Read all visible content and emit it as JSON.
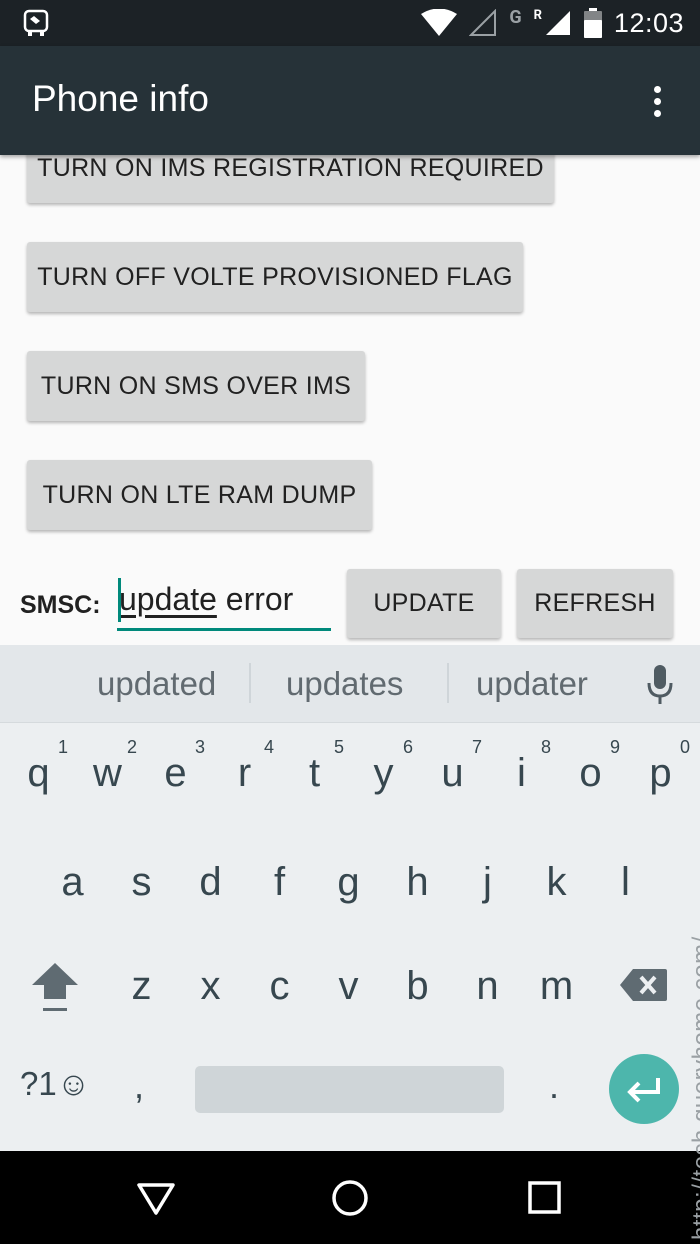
{
  "status_bar": {
    "time": "12:03",
    "network_type": "G",
    "roaming": "R",
    "icons": [
      "app-notification-icon",
      "wifi-icon",
      "signal-empty-icon",
      "signal-roaming-icon",
      "battery-icon"
    ]
  },
  "app_bar": {
    "title": "Phone info",
    "overflow_icon": "more-vert-icon"
  },
  "buttons": [
    {
      "label": "TURN ON IMS REGISTRATION REQUIRED"
    },
    {
      "label": "TURN OFF VOLTE PROVISIONED FLAG"
    },
    {
      "label": "TURN ON SMS OVER IMS"
    },
    {
      "label": "TURN ON LTE RAM DUMP"
    }
  ],
  "smsc": {
    "label": "SMSC:",
    "value_composing": "update",
    "value_rest": " error",
    "update_label": "UPDATE",
    "refresh_label": "REFRESH",
    "accent_color": "#00897b"
  },
  "keyboard": {
    "suggestions": [
      "updated",
      "updates",
      "updater"
    ],
    "row1": [
      {
        "ch": "q",
        "hint": "1"
      },
      {
        "ch": "w",
        "hint": "2"
      },
      {
        "ch": "e",
        "hint": "3"
      },
      {
        "ch": "r",
        "hint": "4"
      },
      {
        "ch": "t",
        "hint": "5"
      },
      {
        "ch": "y",
        "hint": "6"
      },
      {
        "ch": "u",
        "hint": "7"
      },
      {
        "ch": "i",
        "hint": "8"
      },
      {
        "ch": "o",
        "hint": "9"
      },
      {
        "ch": "p",
        "hint": "0"
      }
    ],
    "row2": [
      "a",
      "s",
      "d",
      "f",
      "g",
      "h",
      "j",
      "k",
      "l"
    ],
    "row3": [
      "z",
      "x",
      "c",
      "v",
      "b",
      "n",
      "m"
    ],
    "symbols_label": "?1☺",
    "comma": ",",
    "period": ".",
    "enter_color": "#4db6ac"
  },
  "nav_bar": {
    "icons": [
      "back-icon",
      "home-icon",
      "recents-icon"
    ]
  },
  "watermark": "http://tech.queryhome.com/"
}
